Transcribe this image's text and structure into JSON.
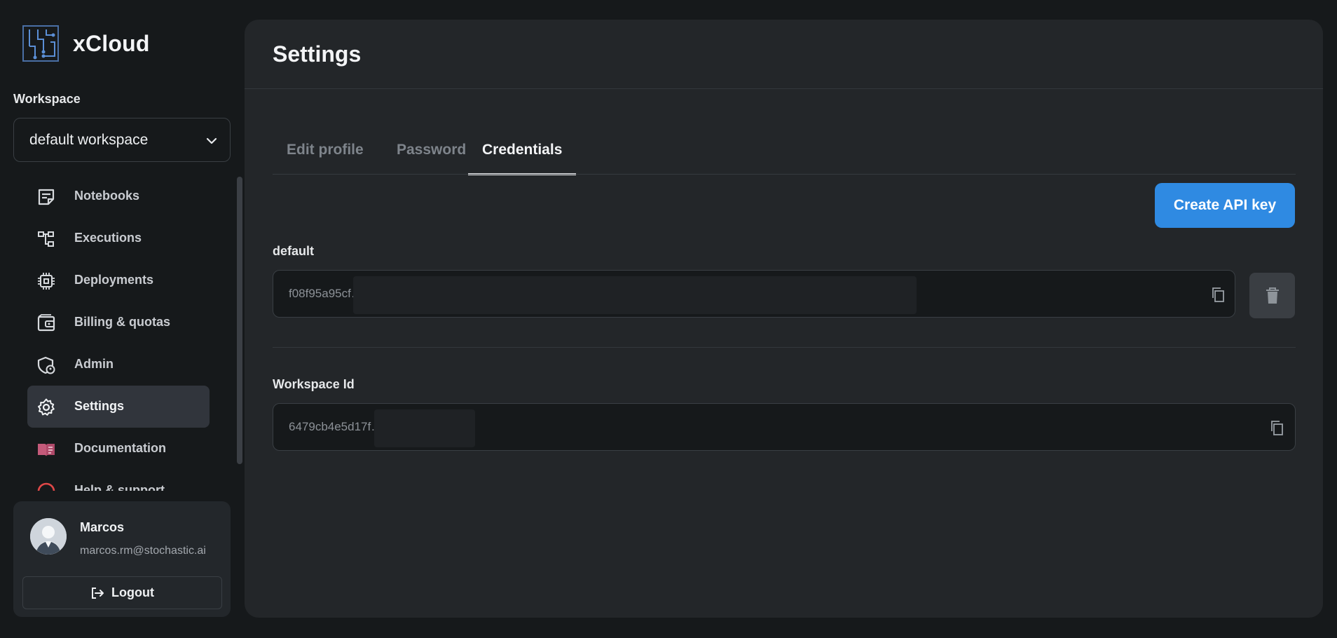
{
  "app": {
    "name": "xCloud"
  },
  "sidebar": {
    "workspace_label": "Workspace",
    "workspace_selected": "default workspace",
    "items": [
      {
        "label": "Notebooks",
        "icon": "notebook-icon",
        "active": false
      },
      {
        "label": "Executions",
        "icon": "executions-icon",
        "active": false
      },
      {
        "label": "Deployments",
        "icon": "chip-icon",
        "active": false
      },
      {
        "label": "Billing & quotas",
        "icon": "wallet-icon",
        "active": false
      },
      {
        "label": "Admin",
        "icon": "shield-icon",
        "active": false
      },
      {
        "label": "Settings",
        "icon": "gear-icon",
        "active": true
      },
      {
        "label": "Documentation",
        "icon": "book-icon",
        "active": false
      },
      {
        "label": "Help & support",
        "icon": "help-icon",
        "active": false
      }
    ]
  },
  "user": {
    "name": "Marcos",
    "email": "marcos.rm@stochastic.ai",
    "logout_label": "Logout"
  },
  "page": {
    "title": "Settings",
    "tabs": [
      {
        "label": "Edit profile",
        "active": false
      },
      {
        "label": "Password",
        "active": false
      },
      {
        "label": "Credentials",
        "active": true
      }
    ],
    "create_button": "Create API key",
    "credentials": [
      {
        "label": "default",
        "value": "f08f95a95cf…"
      }
    ],
    "workspace_id_label": "Workspace Id",
    "workspace_id_value": "6479cb4e5d17f…"
  },
  "colors": {
    "accent": "#2f8ae2",
    "background": "#16191b",
    "panel": "#232629",
    "active_nav": "#31353c"
  }
}
